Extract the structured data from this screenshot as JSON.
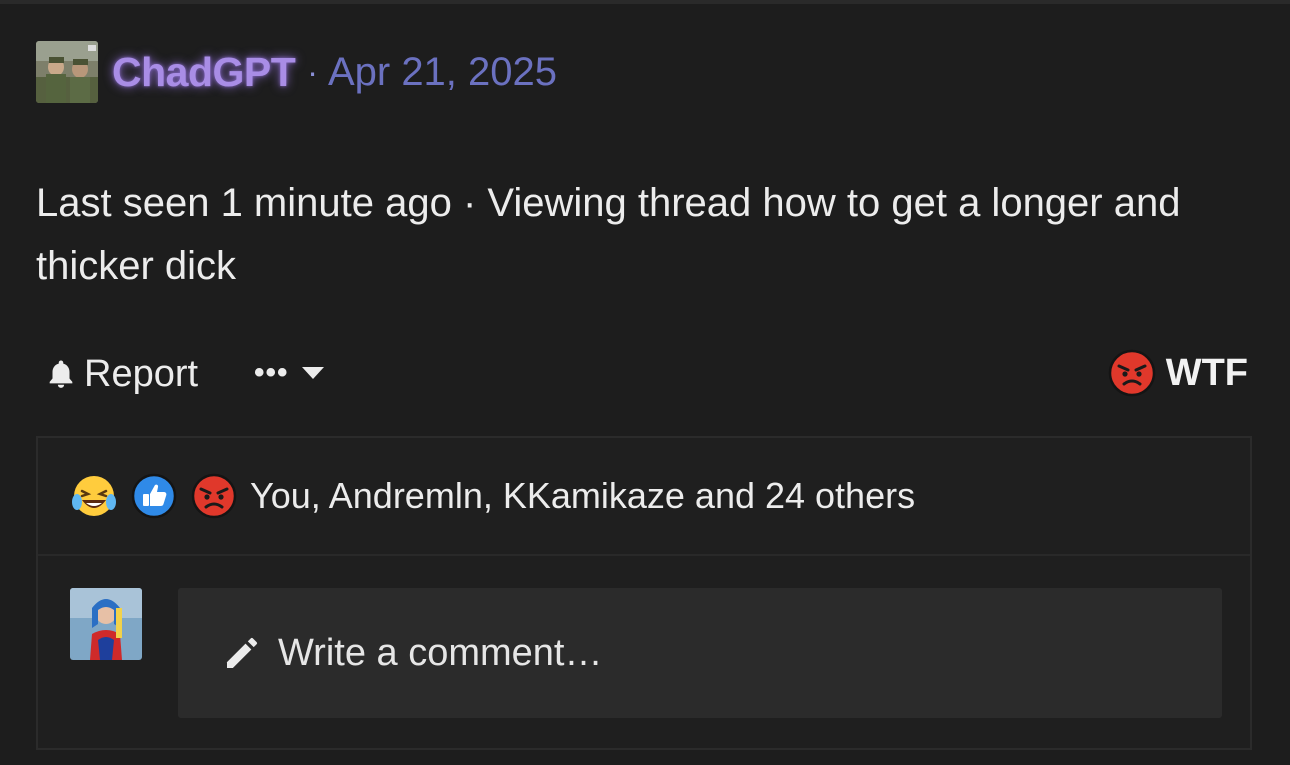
{
  "post": {
    "author": "ChadGPT",
    "separator": "·",
    "date": "Apr 21, 2025",
    "status": "Last seen 1 minute ago · Viewing thread how to get a longer and thicker dick"
  },
  "actions": {
    "report_label": "Report",
    "more_label": "•••",
    "reaction_label": "WTF",
    "reaction_icon": "angry-face-icon"
  },
  "reactions": {
    "icons": [
      "laughing-crying-face-icon",
      "thumbs-up-icon",
      "angry-face-icon"
    ],
    "summary": "You, Andremln, KKamikaze and 24 others"
  },
  "comment_box": {
    "placeholder": "Write a comment…"
  },
  "colors": {
    "background": "#1d1d1d",
    "username": "#a98de6",
    "date": "#6b71c0",
    "input_bg": "#2b2b2b"
  }
}
